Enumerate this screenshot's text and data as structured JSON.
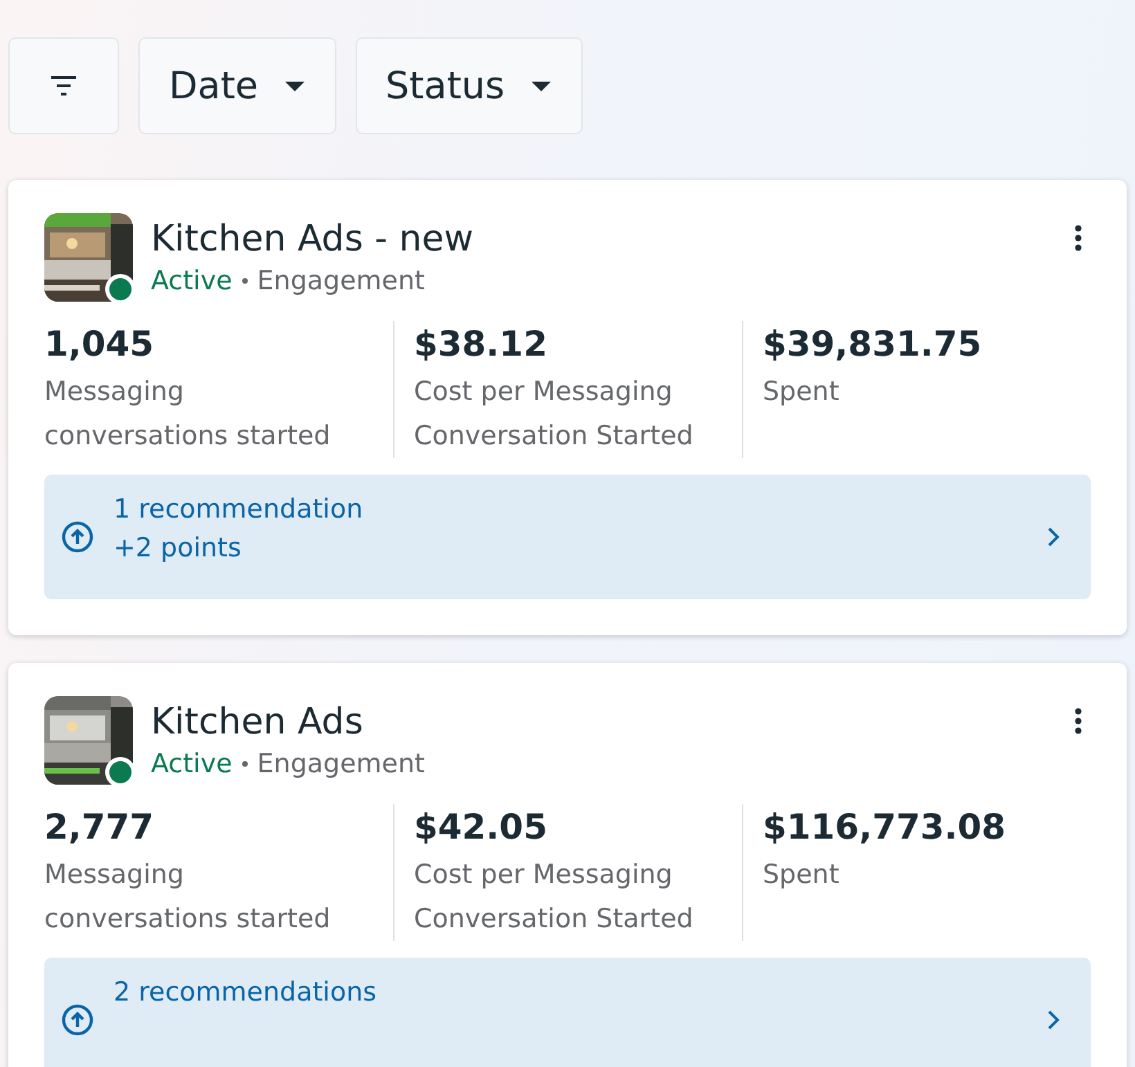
{
  "filters": [
    {
      "kind": "icon"
    },
    {
      "kind": "dropdown",
      "label": "Date"
    },
    {
      "kind": "dropdown",
      "label": "Status"
    }
  ],
  "campaigns": [
    {
      "name": "Kitchen Ads - new",
      "status": "Active",
      "objective": "Engagement",
      "active": true,
      "metrics": [
        {
          "value": "1,045",
          "label": "Messaging conversations started"
        },
        {
          "value": "$38.12",
          "label": "Cost per Messaging Conversation Started"
        },
        {
          "value": "$39,831.75",
          "label": "Spent"
        }
      ],
      "recommendation": {
        "title": "1 recommendation",
        "points": "+2 points"
      }
    },
    {
      "name": "Kitchen Ads",
      "status": "Active",
      "objective": "Engagement",
      "active": true,
      "metrics": [
        {
          "value": "2,777",
          "label": "Messaging conversations started"
        },
        {
          "value": "$42.05",
          "label": "Cost per Messaging Conversation Started"
        },
        {
          "value": "$116,773.08",
          "label": "Spent"
        }
      ],
      "recommendation": {
        "title": "2 recommendations"
      }
    }
  ]
}
